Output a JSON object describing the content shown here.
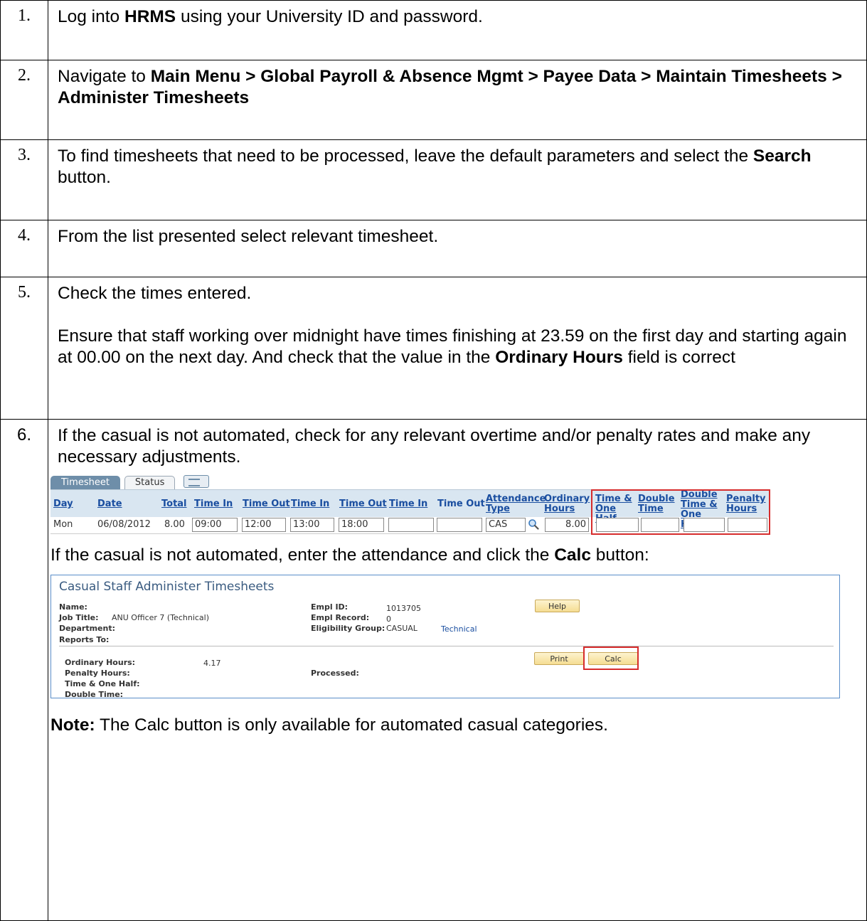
{
  "steps": [
    {
      "num": "1.",
      "parts": [
        "Log into ",
        "HRMS",
        " using your University ID and password."
      ]
    },
    {
      "num": "2.",
      "parts": [
        "Navigate to ",
        "Main Menu > Global Payroll & Absence Mgmt > Payee Data > Maintain Timesheets > Administer Timesheets"
      ]
    },
    {
      "num": "3.",
      "parts": [
        "To find timesheets that need to be processed, leave the default parameters and select the ",
        "Search",
        " button."
      ]
    },
    {
      "num": "4.",
      "text": "From the list presented select relevant timesheet."
    },
    {
      "num": "5.",
      "line1": "Check the times entered.",
      "para2": [
        "Ensure that staff working over midnight have times finishing at 23.59 on the first day and starting again at 00.00 on the next day.  And check that the value in the ",
        "Ordinary Hours",
        " field is correct"
      ]
    },
    {
      "num": "6.",
      "intro": "If the casual is not automated, check for any relevant overtime and/or penalty rates and make any necessary adjustments.",
      "calc_text": [
        "If the casual is not automated, enter the attendance and click the ",
        "Calc",
        " button:"
      ],
      "note": [
        "Note:",
        " The Calc button is only available for automated casual categories."
      ]
    }
  ],
  "timesheet": {
    "tabs": [
      "Timesheet",
      "Status"
    ],
    "headers": [
      "Day",
      "Date",
      "Total",
      "Time In",
      "Time Out",
      "Time In",
      "Time Out",
      "Time In",
      "Time Out",
      "Attendance Type",
      "Ordinary Hours",
      "Time & One Half",
      "Double Time",
      "Double Time & One Half",
      "Penalty Hours"
    ],
    "row": {
      "day": "Mon",
      "date": "06/08/2012",
      "total": "8.00",
      "in1": "09:00",
      "out1": "12:00",
      "in2": "13:00",
      "out2": "18:00",
      "in3": "",
      "out3": "",
      "attendance": "CAS",
      "ordinary": "8.00"
    }
  },
  "casual": {
    "title": "Casual Staff Administer Timesheets",
    "name_label": "Name:",
    "job_label": "Job Title:",
    "job_value": "ANU Officer 7 (Technical)",
    "dept_label": "Department:",
    "reports_label": "Reports To:",
    "emplid_label": "Empl ID:",
    "emplid_value": "1013705",
    "emplrec_label": "Empl Record:",
    "emplrec_value": "0",
    "elig_label": "Eligibility Group:",
    "elig_value": "CASUAL",
    "elig_link": "Technical",
    "help_btn": "Help",
    "print_btn": "Print",
    "calc_btn": "Calc",
    "ord_label": "Ordinary Hours:",
    "ord_value": "4.17",
    "pen_label": "Penalty Hours:",
    "toh_label": "Time & One Half:",
    "dt_label": "Double Time:",
    "processed_label": "Processed:"
  }
}
